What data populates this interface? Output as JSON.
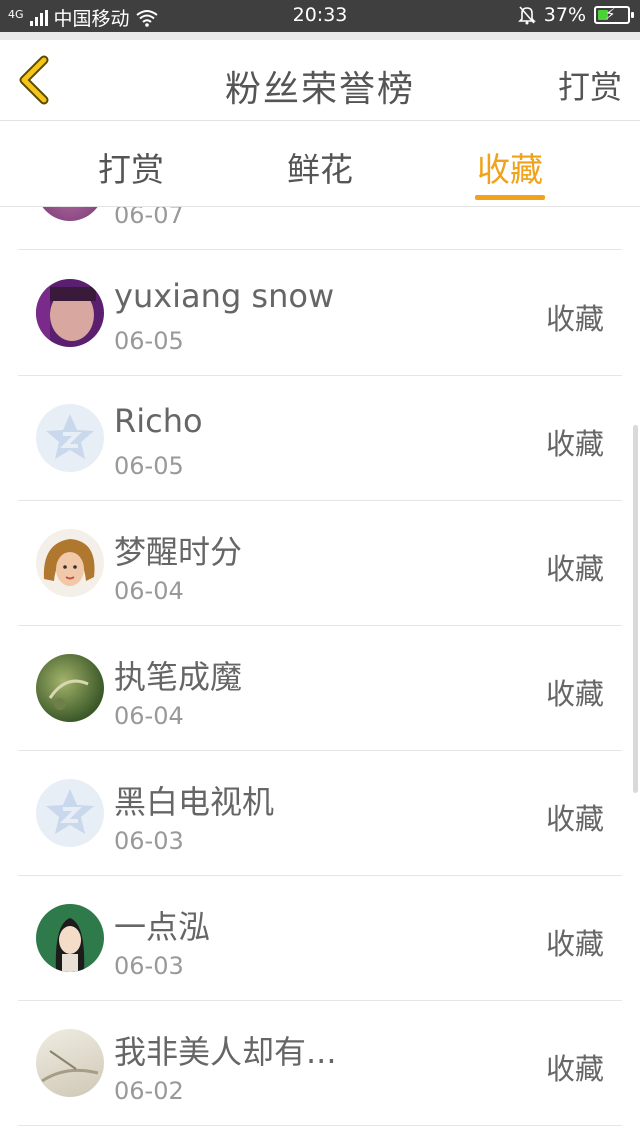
{
  "status_bar": {
    "network": "4G",
    "carrier": "中国移动",
    "time": "20:33",
    "battery": "37%",
    "battery_level": 0.37
  },
  "header": {
    "title": "粉丝荣誉榜",
    "action": "打赏",
    "back_icon": "chevron-left-icon"
  },
  "tabs": [
    {
      "label": "打赏",
      "active": false
    },
    {
      "label": "鲜花",
      "active": false
    },
    {
      "label": "收藏",
      "active": true
    }
  ],
  "list": {
    "partial_row": {
      "date": "06-07"
    },
    "rows": [
      {
        "name": "yuxiang snow",
        "date": "06-05",
        "action": "收藏",
        "avatar": "photo"
      },
      {
        "name": "Richo",
        "date": "06-05",
        "action": "收藏",
        "avatar": "default-qq-star"
      },
      {
        "name": "梦醒时分",
        "date": "06-04",
        "action": "收藏",
        "avatar": "cartoon-girl"
      },
      {
        "name": "执笔成魔",
        "date": "06-04",
        "action": "收藏",
        "avatar": "green-art"
      },
      {
        "name": "黑白电视机",
        "date": "06-03",
        "action": "收藏",
        "avatar": "default-qq-star"
      },
      {
        "name": "一点泓",
        "date": "06-03",
        "action": "收藏",
        "avatar": "portrait-girl"
      },
      {
        "name": "我非美人却有...",
        "date": "06-02",
        "action": "收藏",
        "avatar": "light-art"
      }
    ]
  },
  "colors": {
    "accent": "#f0a21b",
    "status_bar_bg": "#3f3f3f",
    "battery_fill": "#4cd137",
    "text": "#666666",
    "subtext": "#999999"
  }
}
